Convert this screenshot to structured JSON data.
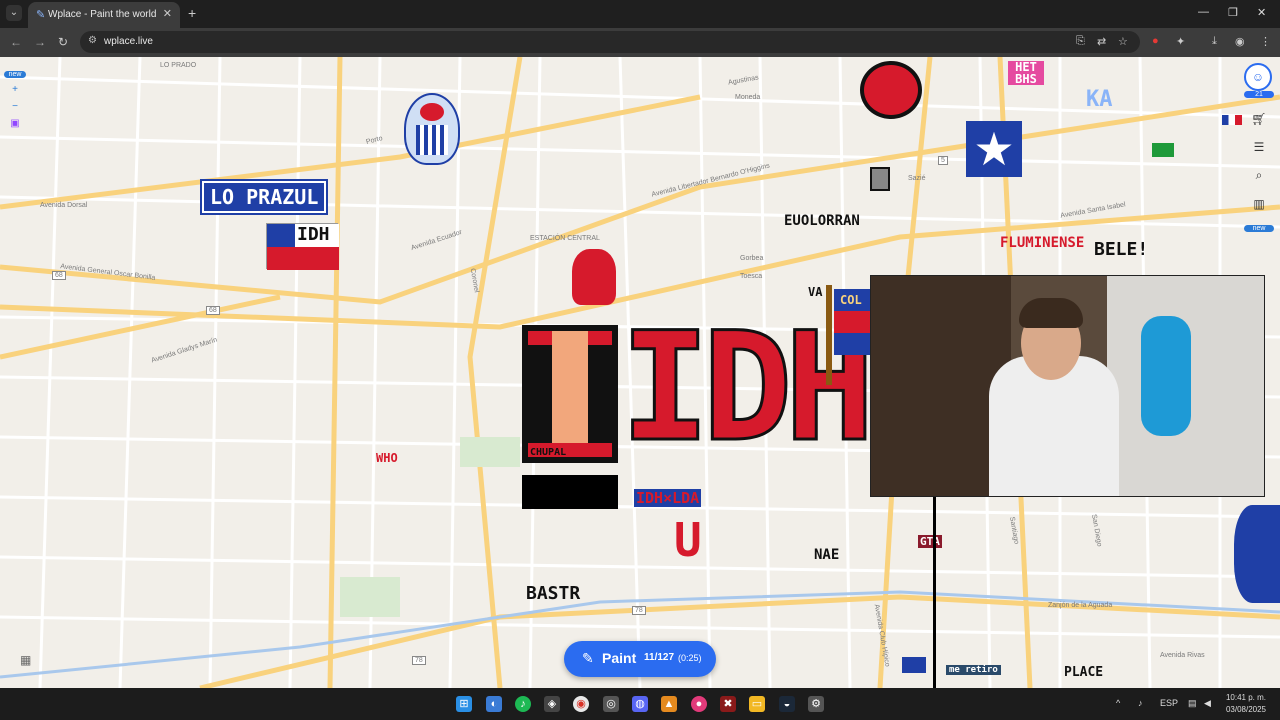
{
  "browser": {
    "tab_title": "Wplace - Paint the world",
    "url": "wplace.live"
  },
  "map": {
    "streets": [
      "LO PRADO",
      "Avenida Dorsal",
      "Avenida General Oscar Bonilla",
      "Avenida Gladys Marín",
      "Avenida Ecuador",
      "ESTACIÓN CENTRAL",
      "Avenida Libertador Bernardo O'Higgins",
      "Agustinas",
      "Moneda",
      "Gorbea",
      "Toesca",
      "Sazié",
      "Avenida Santa Isabel",
      "Porto",
      "Coronel",
      "Zanjón de la Aguada",
      "Avenida Club Hípico",
      "Avenida Rivas",
      "San Diego",
      "Santiago"
    ],
    "route_badges": [
      "68",
      "68",
      "78",
      "78",
      "5"
    ],
    "left_badge": "new",
    "right_badge_count": "21",
    "right_badge_new": "new"
  },
  "pixel_art": {
    "lo_prazul": "LO PRAZUL",
    "idh_small": "IDH",
    "idh_big": "IDH",
    "chupal": "CHUPAL",
    "idh_x_lda": "IDH×LDA",
    "u": "U",
    "bastr": "BASTR",
    "nae": "NAE",
    "euolorran": "EUOLORRAN",
    "fluminense": "FLUMINENSE",
    "belei": "BELE!",
    "ka": "KA",
    "het_bhs": "HET BHS",
    "who": "WHO",
    "va": "VA",
    "col": "COL",
    "gta": "GTA",
    "place": "PLACE",
    "me_retiro": "me retiro"
  },
  "paint_button": {
    "label": "Paint",
    "charges": "11/127",
    "timer": "(0:25)"
  },
  "taskbar": {
    "lang": "ESP",
    "time": "10:41 p. m.",
    "date": "03/08/2025"
  },
  "colors": {
    "accent": "#2b6cf0",
    "idh_red": "#d61a2c",
    "road": "#f9d27d",
    "chile_blue": "#1f3fa6"
  }
}
